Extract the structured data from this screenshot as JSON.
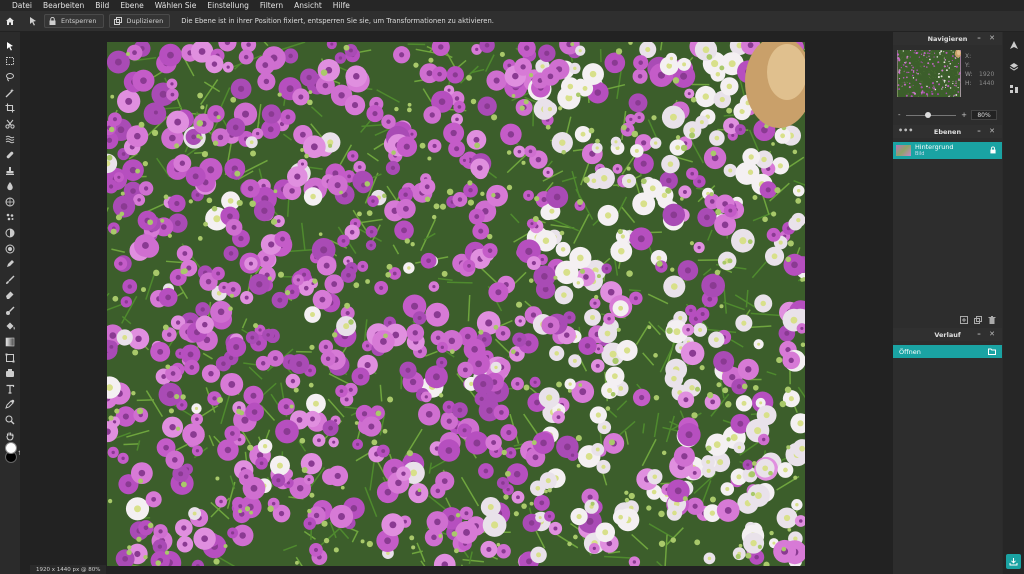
{
  "menu": [
    "Datei",
    "Bearbeiten",
    "Bild",
    "Ebene",
    "Wählen Sie",
    "Einstellung",
    "Filtern",
    "Ansicht",
    "Hilfe"
  ],
  "options": {
    "unlock_label": "Entsperren",
    "duplicate_label": "Duplizieren",
    "info": "Die Ebene ist in ihrer Position fixiert, entsperren Sie sie, um Transformationen zu aktivieren."
  },
  "navigator": {
    "title": "Navigieren",
    "x_label": "X:",
    "y_label": "Y:",
    "w_label": "W:",
    "w_value": "1920",
    "h_label": "H:",
    "h_value": "1440",
    "zoom_minus": "-",
    "zoom_plus": "+",
    "zoom_value": "80%",
    "zoom_fraction": 0.38
  },
  "layers": {
    "title": "Ebenen",
    "items": [
      {
        "name": "Hintergrund",
        "sub": "Bild"
      }
    ]
  },
  "history": {
    "title": "Verlauf",
    "items": [
      "Öffnen"
    ]
  },
  "status": "1920 x 1440 px @ 80%",
  "colors": {
    "accent": "#1aa3a3",
    "foreground": "#ffffff",
    "background": "#000000"
  },
  "icons": {
    "home": "home-icon",
    "move": "move-arrow-icon",
    "lock": "lock-icon",
    "duplicate": "duplicate-icon",
    "tools": [
      "move-tool-icon",
      "marquee-tool-icon",
      "lasso-tool-icon",
      "magic-wand-icon",
      "crop-tool-icon",
      "cut-tool-icon",
      "liquify-icon",
      "healing-brush-icon",
      "clone-stamp-icon",
      "blur-tool-icon",
      "sponge-icon",
      "sharpen-icon",
      "dodge-icon",
      "burn-icon",
      "pen-tool-icon",
      "brush-tool-icon",
      "eraser-icon",
      "color-replace-icon",
      "fill-bucket-icon",
      "gradient-icon",
      "shape-tool-icon",
      "stamp-tool-icon",
      "text-tool-icon",
      "eyedropper-icon",
      "zoom-tool-icon",
      "hand-tool-icon"
    ]
  }
}
